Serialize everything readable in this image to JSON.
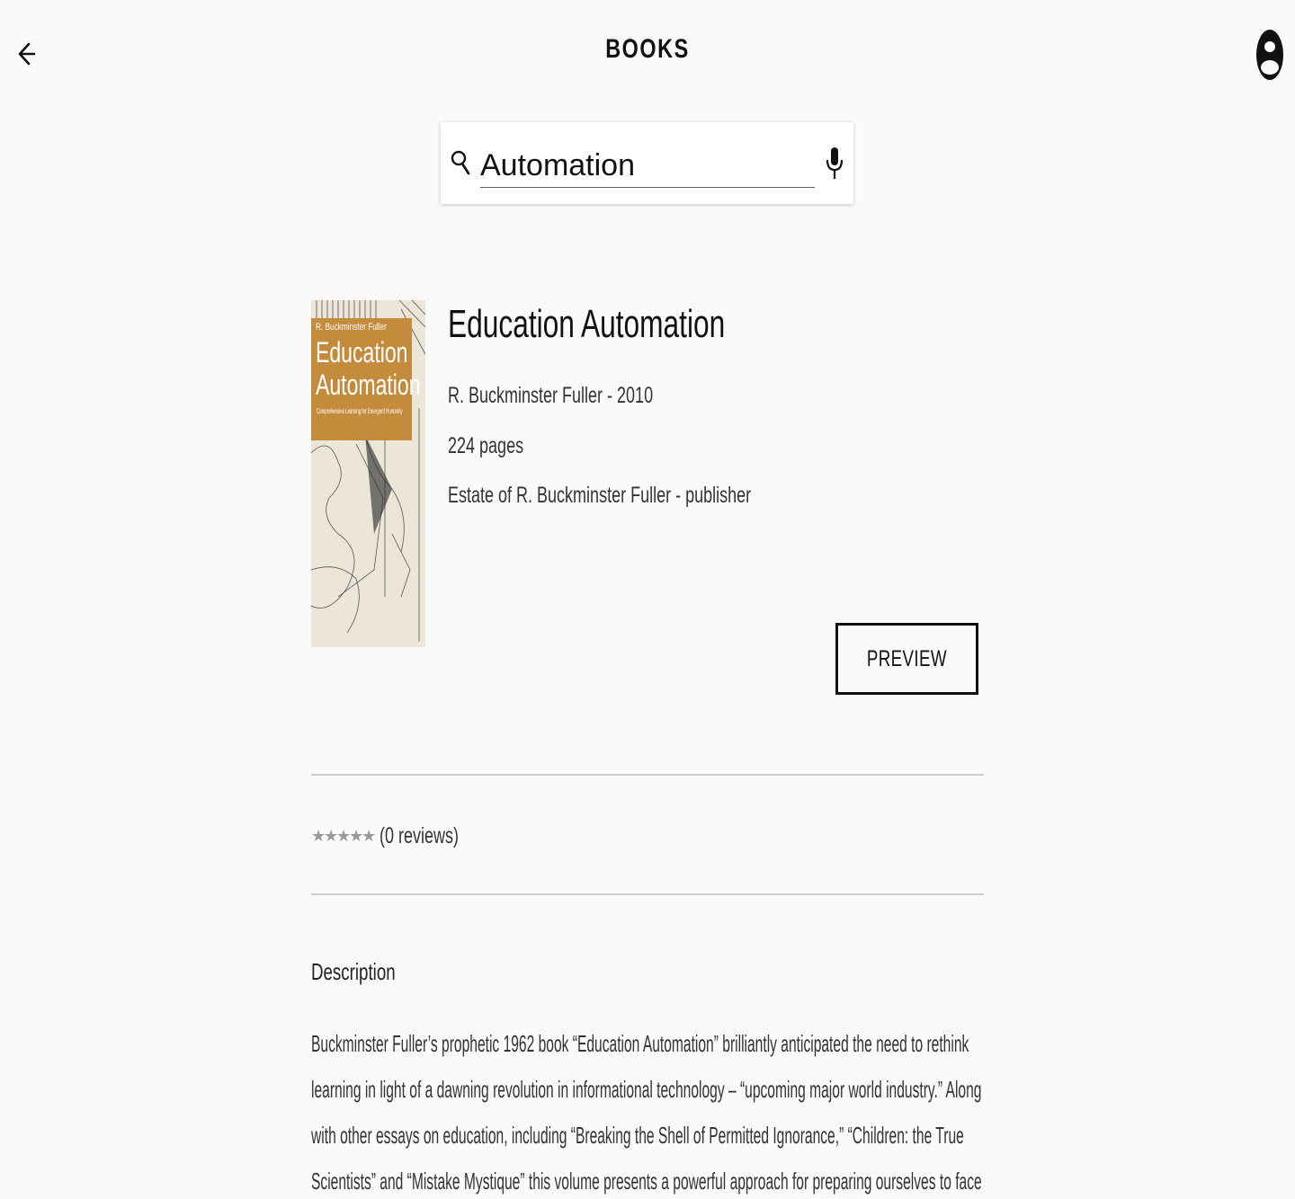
{
  "header": {
    "title": "BOOKS"
  },
  "search": {
    "query": "Automation"
  },
  "book": {
    "title": "Education Automation",
    "author_year": "R. Buckminster Fuller - 2010",
    "pages": "224 pages",
    "publisher": "Estate of R. Buckminster Fuller - publisher",
    "cover": {
      "author": "R. Buckminster Fuller",
      "title_line1": "Education",
      "title_line2": "Automation",
      "subtitle": "Comprehensive Learning for Emergent Humanity",
      "accent_color": "#c48b3c",
      "paper_color": "#ebe6d8"
    },
    "preview_label": "PREVIEW",
    "rating": {
      "stars": 0,
      "max_stars": 5,
      "reviews_text": "(0 reviews)"
    }
  },
  "description": {
    "heading": "Description",
    "lines": [
      "Buckminster Fuller’s prophetic 1962 book “Education Automation” brilliantly anticipated the need to rethink",
      "learning in light of a dawning revolution in informational technology – “upcoming major world industry.” Along",
      "with other essays on education, including “Breaking the Shell of Permitted Ignorance,” “Children: the True",
      "Scientists” and “Mistake Mystique” this volume presents a powerful approach for preparing ourselves to face"
    ]
  },
  "icons": {
    "back": "arrow-left-icon",
    "account": "account-icon",
    "search": "search-icon",
    "mic": "microphone-icon",
    "star": "star-icon"
  }
}
